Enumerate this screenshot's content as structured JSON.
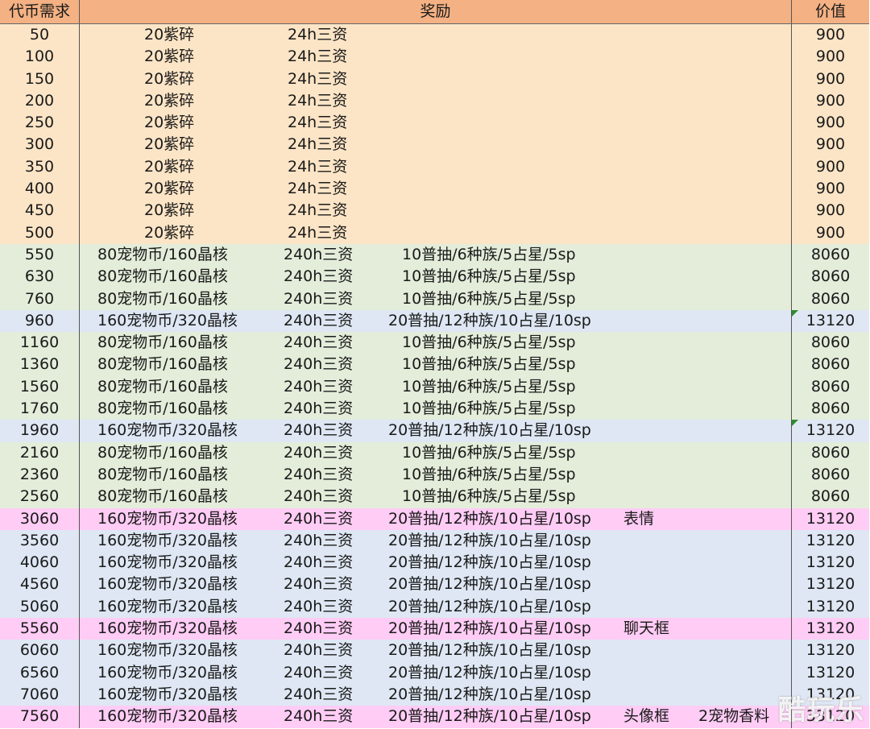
{
  "table": {
    "headers": {
      "cost": "代币需求",
      "reward": "奖励",
      "value": "价值"
    },
    "rows": [
      {
        "cost": "50",
        "r1": "20紫碎",
        "r2": "24h三资",
        "r3": "",
        "r4": "",
        "r5": "",
        "value": "900",
        "color": "orange",
        "marker": false
      },
      {
        "cost": "100",
        "r1": "20紫碎",
        "r2": "24h三资",
        "r3": "",
        "r4": "",
        "r5": "",
        "value": "900",
        "color": "orange",
        "marker": false
      },
      {
        "cost": "150",
        "r1": "20紫碎",
        "r2": "24h三资",
        "r3": "",
        "r4": "",
        "r5": "",
        "value": "900",
        "color": "orange",
        "marker": false
      },
      {
        "cost": "200",
        "r1": "20紫碎",
        "r2": "24h三资",
        "r3": "",
        "r4": "",
        "r5": "",
        "value": "900",
        "color": "orange",
        "marker": false
      },
      {
        "cost": "250",
        "r1": "20紫碎",
        "r2": "24h三资",
        "r3": "",
        "r4": "",
        "r5": "",
        "value": "900",
        "color": "orange",
        "marker": false
      },
      {
        "cost": "300",
        "r1": "20紫碎",
        "r2": "24h三资",
        "r3": "",
        "r4": "",
        "r5": "",
        "value": "900",
        "color": "orange",
        "marker": false
      },
      {
        "cost": "350",
        "r1": "20紫碎",
        "r2": "24h三资",
        "r3": "",
        "r4": "",
        "r5": "",
        "value": "900",
        "color": "orange",
        "marker": false
      },
      {
        "cost": "400",
        "r1": "20紫碎",
        "r2": "24h三资",
        "r3": "",
        "r4": "",
        "r5": "",
        "value": "900",
        "color": "orange",
        "marker": false
      },
      {
        "cost": "450",
        "r1": "20紫碎",
        "r2": "24h三资",
        "r3": "",
        "r4": "",
        "r5": "",
        "value": "900",
        "color": "orange",
        "marker": false
      },
      {
        "cost": "500",
        "r1": "20紫碎",
        "r2": "24h三资",
        "r3": "",
        "r4": "",
        "r5": "",
        "value": "900",
        "color": "orange",
        "marker": false
      },
      {
        "cost": "550",
        "r1": "80宠物币/160晶核",
        "r2": "240h三资",
        "r3": "10普抽/6种族/5占星/5sp",
        "r4": "",
        "r5": "",
        "value": "8060",
        "color": "green",
        "marker": false
      },
      {
        "cost": "630",
        "r1": "80宠物币/160晶核",
        "r2": "240h三资",
        "r3": "10普抽/6种族/5占星/5sp",
        "r4": "",
        "r5": "",
        "value": "8060",
        "color": "green",
        "marker": false
      },
      {
        "cost": "760",
        "r1": "80宠物币/160晶核",
        "r2": "240h三资",
        "r3": "10普抽/6种族/5占星/5sp",
        "r4": "",
        "r5": "",
        "value": "8060",
        "color": "green",
        "marker": false
      },
      {
        "cost": "960",
        "r1": "160宠物币/320晶核",
        "r2": "240h三资",
        "r3": "20普抽/12种族/10占星/10sp",
        "r4": "",
        "r5": "",
        "value": "13120",
        "color": "blue",
        "marker": true
      },
      {
        "cost": "1160",
        "r1": "80宠物币/160晶核",
        "r2": "240h三资",
        "r3": "10普抽/6种族/5占星/5sp",
        "r4": "",
        "r5": "",
        "value": "8060",
        "color": "green",
        "marker": false
      },
      {
        "cost": "1360",
        "r1": "80宠物币/160晶核",
        "r2": "240h三资",
        "r3": "10普抽/6种族/5占星/5sp",
        "r4": "",
        "r5": "",
        "value": "8060",
        "color": "green",
        "marker": false
      },
      {
        "cost": "1560",
        "r1": "80宠物币/160晶核",
        "r2": "240h三资",
        "r3": "10普抽/6种族/5占星/5sp",
        "r4": "",
        "r5": "",
        "value": "8060",
        "color": "green",
        "marker": false
      },
      {
        "cost": "1760",
        "r1": "80宠物币/160晶核",
        "r2": "240h三资",
        "r3": "10普抽/6种族/5占星/5sp",
        "r4": "",
        "r5": "",
        "value": "8060",
        "color": "green",
        "marker": false
      },
      {
        "cost": "1960",
        "r1": "160宠物币/320晶核",
        "r2": "240h三资",
        "r3": "20普抽/12种族/10占星/10sp",
        "r4": "",
        "r5": "",
        "value": "13120",
        "color": "blue",
        "marker": true
      },
      {
        "cost": "2160",
        "r1": "80宠物币/160晶核",
        "r2": "240h三资",
        "r3": "10普抽/6种族/5占星/5sp",
        "r4": "",
        "r5": "",
        "value": "8060",
        "color": "green",
        "marker": false
      },
      {
        "cost": "2360",
        "r1": "80宠物币/160晶核",
        "r2": "240h三资",
        "r3": "10普抽/6种族/5占星/5sp",
        "r4": "",
        "r5": "",
        "value": "8060",
        "color": "green",
        "marker": false
      },
      {
        "cost": "2560",
        "r1": "80宠物币/160晶核",
        "r2": "240h三资",
        "r3": "10普抽/6种族/5占星/5sp",
        "r4": "",
        "r5": "",
        "value": "8060",
        "color": "green",
        "marker": false
      },
      {
        "cost": "3060",
        "r1": "160宠物币/320晶核",
        "r2": "240h三资",
        "r3": "20普抽/12种族/10占星/10sp",
        "r4": "表情",
        "r5": "",
        "value": "13120",
        "color": "pink",
        "marker": false
      },
      {
        "cost": "3560",
        "r1": "160宠物币/320晶核",
        "r2": "240h三资",
        "r3": "20普抽/12种族/10占星/10sp",
        "r4": "",
        "r5": "",
        "value": "13120",
        "color": "blue",
        "marker": false
      },
      {
        "cost": "4060",
        "r1": "160宠物币/320晶核",
        "r2": "240h三资",
        "r3": "20普抽/12种族/10占星/10sp",
        "r4": "",
        "r5": "",
        "value": "13120",
        "color": "blue",
        "marker": false
      },
      {
        "cost": "4560",
        "r1": "160宠物币/320晶核",
        "r2": "240h三资",
        "r3": "20普抽/12种族/10占星/10sp",
        "r4": "",
        "r5": "",
        "value": "13120",
        "color": "blue",
        "marker": false
      },
      {
        "cost": "5060",
        "r1": "160宠物币/320晶核",
        "r2": "240h三资",
        "r3": "20普抽/12种族/10占星/10sp",
        "r4": "",
        "r5": "",
        "value": "13120",
        "color": "blue",
        "marker": false
      },
      {
        "cost": "5560",
        "r1": "160宠物币/320晶核",
        "r2": "240h三资",
        "r3": "20普抽/12种族/10占星/10sp",
        "r4": "聊天框",
        "r5": "",
        "value": "13120",
        "color": "pink",
        "marker": false
      },
      {
        "cost": "6060",
        "r1": "160宠物币/320晶核",
        "r2": "240h三资",
        "r3": "20普抽/12种族/10占星/10sp",
        "r4": "",
        "r5": "",
        "value": "13120",
        "color": "blue",
        "marker": false
      },
      {
        "cost": "6560",
        "r1": "160宠物币/320晶核",
        "r2": "240h三资",
        "r3": "20普抽/12种族/10占星/10sp",
        "r4": "",
        "r5": "",
        "value": "13120",
        "color": "blue",
        "marker": false
      },
      {
        "cost": "7060",
        "r1": "160宠物币/320晶核",
        "r2": "240h三资",
        "r3": "20普抽/12种族/10占星/10sp",
        "r4": "",
        "r5": "",
        "value": "13120",
        "color": "blue",
        "marker": false
      },
      {
        "cost": "7560",
        "r1": "160宠物币/320晶核",
        "r2": "240h三资",
        "r3": "20普抽/12种族/10占星/10sp",
        "r4": "头像框",
        "r5": "2宠物香料",
        "value": "33120",
        "color": "pink",
        "marker": false
      }
    ]
  },
  "watermark": "酷玩乐",
  "colors": {
    "header": "#F4B183",
    "orange": "#FCE5C6",
    "green": "#E3EDDA",
    "blue": "#DEE7F3",
    "pink": "#FFCCF5",
    "marker": "#2e8b2e"
  }
}
